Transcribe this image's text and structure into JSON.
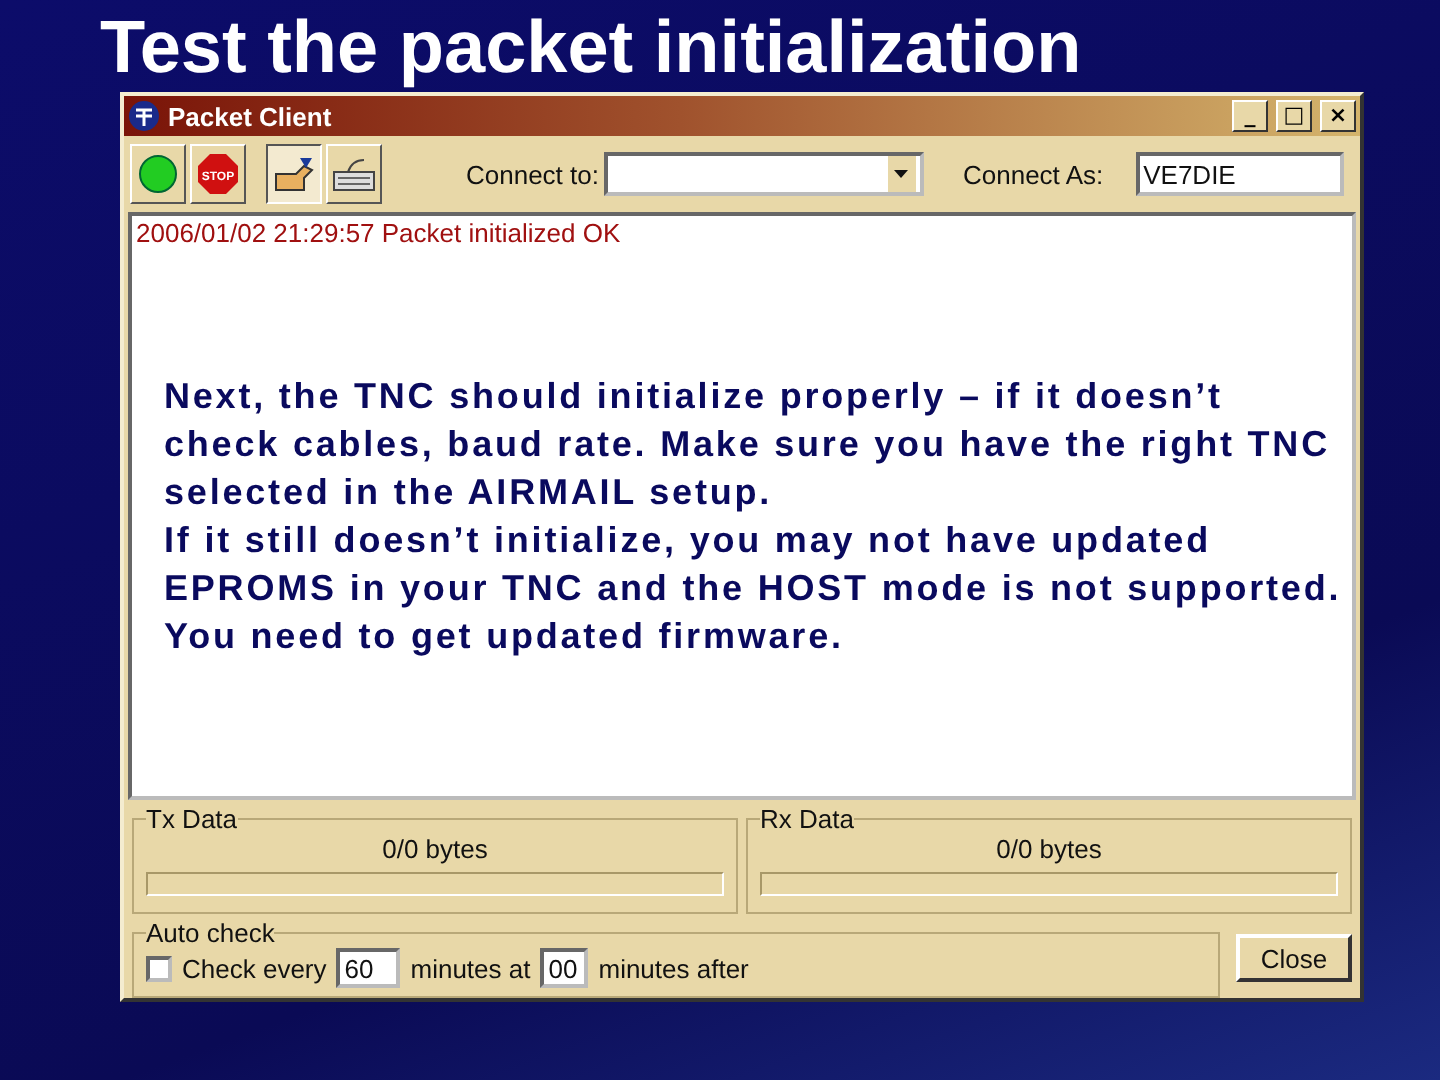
{
  "slide": {
    "title": "Test the packet initialization"
  },
  "window": {
    "title": "Packet Client",
    "controls": [
      "_",
      "□",
      "×"
    ]
  },
  "toolbar": {
    "buttons": [
      {
        "kind": "go"
      },
      {
        "kind": "stop",
        "label": "STOP"
      },
      {
        "kind": "connect",
        "selected": true
      },
      {
        "kind": "keyboard",
        "selected": false
      }
    ],
    "connect_to": {
      "label": "Connect to:"
    },
    "connect_as": {
      "label": "Connect As:",
      "value": "VE7DIE"
    }
  },
  "log": [
    "2006/01/02 21:29:57 Packet initialized OK"
  ],
  "note": [
    "Next, the TNC should initialize properly – if it doesn’t check cables,  baud rate.  Make sure you have the right TNC selected in the AIRMAIL setup.",
    "If it still doesn’t initialize, you may not have updated EPROMS in your TNC and the HOST mode is not supported. You need to get updated firmware."
  ],
  "tx": {
    "title": "Tx Data",
    "reading": "0/0 bytes"
  },
  "rx": {
    "title": "Rx Data",
    "reading": "0/0 bytes"
  },
  "auto_check": {
    "title": "Auto check",
    "checked": false,
    "label": "Check every",
    "minutes": "60",
    "middle": "minutes at",
    "after": "00",
    "end": "minutes after"
  },
  "close_button": "Close"
}
